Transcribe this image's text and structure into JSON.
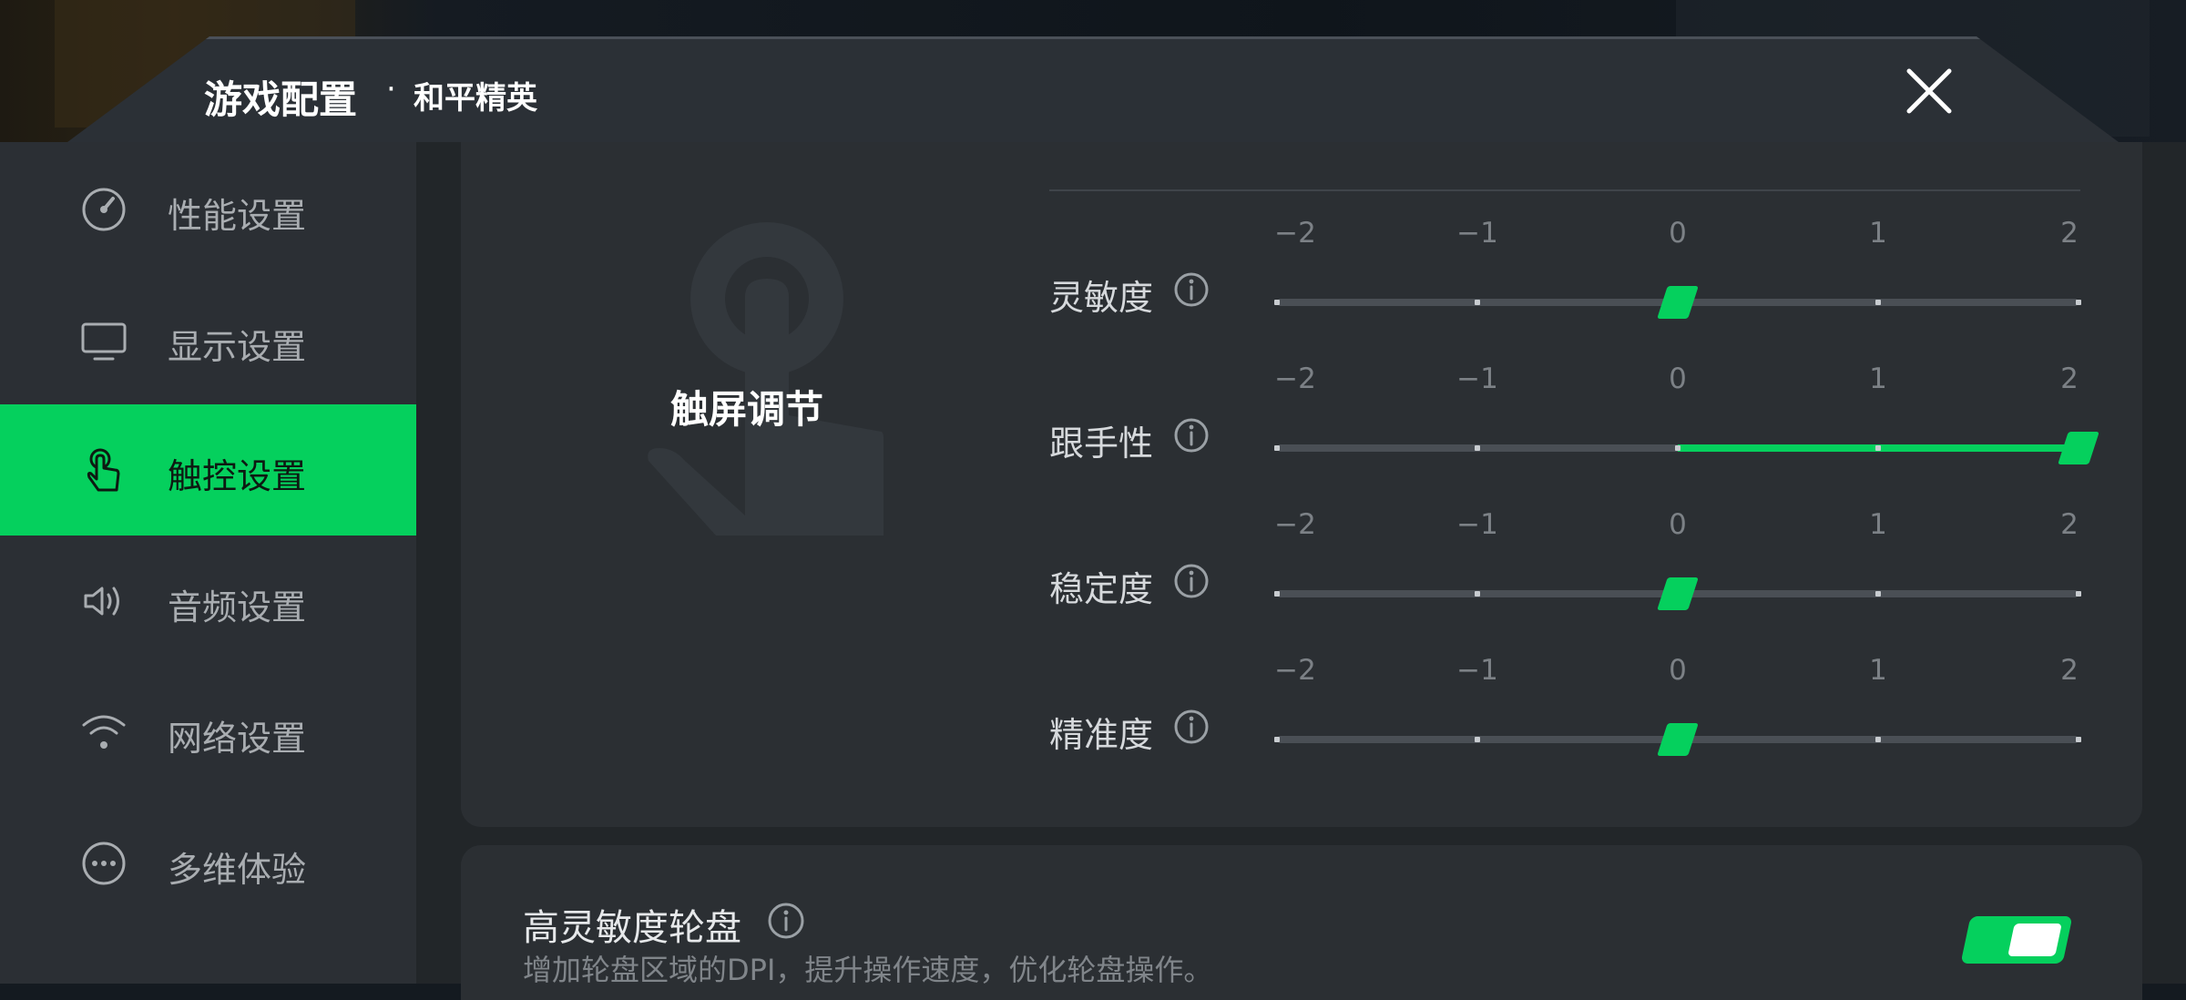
{
  "header": {
    "title": "游戏配置",
    "separator": "·",
    "subtitle": "和平精英",
    "close_icon": "close-icon"
  },
  "sidebar": {
    "items": [
      {
        "label": "性能设置",
        "icon": "speedometer-icon",
        "active": false
      },
      {
        "label": "显示设置",
        "icon": "monitor-icon",
        "active": false
      },
      {
        "label": "触控设置",
        "icon": "touch-hand-icon",
        "active": true
      },
      {
        "label": "音频设置",
        "icon": "speaker-icon",
        "active": false
      },
      {
        "label": "网络设置",
        "icon": "wifi-icon",
        "active": false
      },
      {
        "label": "多维体验",
        "icon": "more-dots-icon",
        "active": false
      }
    ]
  },
  "touch_panel": {
    "title": "触屏调节",
    "tick_labels": [
      "−2",
      "−1",
      "0",
      "1",
      "2"
    ],
    "sliders": [
      {
        "label": "灵敏度",
        "value": 0
      },
      {
        "label": "跟手性",
        "value": 2
      },
      {
        "label": "稳定度",
        "value": 0
      },
      {
        "label": "精准度",
        "value": 0
      }
    ]
  },
  "high_sensitivity": {
    "title": "高灵敏度轮盘",
    "description": "增加轮盘区域的DPI，提升操作速度，优化轮盘操作。",
    "enabled": true
  },
  "colors": {
    "accent": "#05d05d",
    "panel": "#2b2f33",
    "sidebar": "#2b2f34"
  }
}
